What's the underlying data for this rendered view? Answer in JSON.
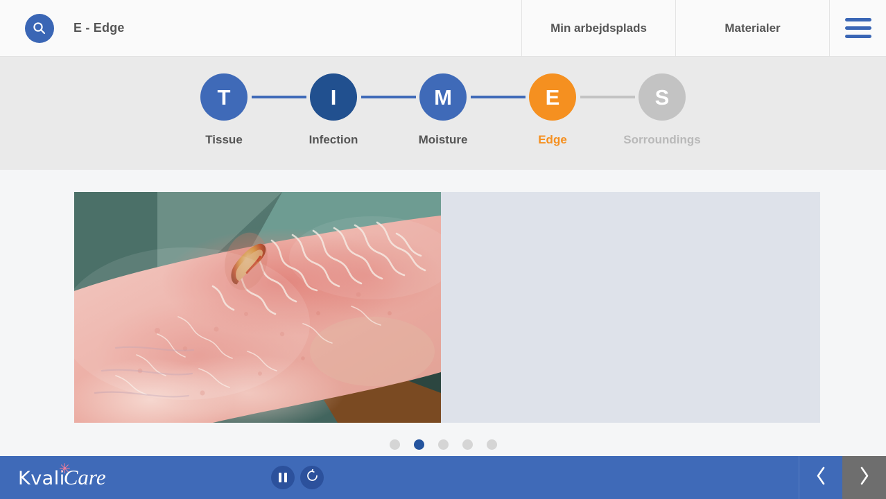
{
  "header": {
    "logo_icon": "search-icon",
    "title": "E - Edge",
    "nav": [
      {
        "label": "Min arbejdsplads"
      },
      {
        "label": "Materialer"
      }
    ],
    "menu_icon": "hamburger-menu-icon"
  },
  "stepper": {
    "steps": [
      {
        "letter": "T",
        "label": "Tissue",
        "state": "visited",
        "circle_color": "#3f6ab8",
        "label_color": "#555555"
      },
      {
        "letter": "I",
        "label": "Infection",
        "state": "visited",
        "circle_color": "#21508f",
        "label_color": "#555555"
      },
      {
        "letter": "M",
        "label": "Moisture",
        "state": "visited",
        "circle_color": "#3f6ab8",
        "label_color": "#555555"
      },
      {
        "letter": "E",
        "label": "Edge",
        "state": "active",
        "circle_color": "#f59020",
        "label_color": "#f59020"
      },
      {
        "letter": "S",
        "label": "Sorroundings",
        "state": "disabled",
        "circle_color": "#c3c3c3",
        "label_color": "#b9b9b9"
      }
    ],
    "connectors": [
      {
        "color": "#3f6ab8"
      },
      {
        "color": "#3f6ab8"
      },
      {
        "color": "#3f6ab8"
      },
      {
        "color": "#c3c3c3"
      }
    ]
  },
  "carousel": {
    "prev_icon": "chevron-left-icon",
    "next_icon": "chevron-right-icon",
    "image_alt": "Clinical wound photo of inflamed lower leg with macerated edge",
    "panel_color": "#dee2ea",
    "dots": [
      {
        "active": false
      },
      {
        "active": true
      },
      {
        "active": false
      },
      {
        "active": false
      },
      {
        "active": false
      }
    ],
    "active_index": 1,
    "total": 5
  },
  "footer": {
    "logo": {
      "part1": "Kvali",
      "part2": "Care",
      "flower": "✳",
      "flower_color": "#ef7d9a"
    },
    "controls": [
      {
        "name": "pause-button",
        "icon": "pause-icon"
      },
      {
        "name": "replay-button",
        "icon": "replay-icon"
      }
    ],
    "nav": {
      "prev_icon": "chevron-left-icon",
      "next_icon": "chevron-right-icon"
    },
    "background_color": "#3f6ab8"
  }
}
